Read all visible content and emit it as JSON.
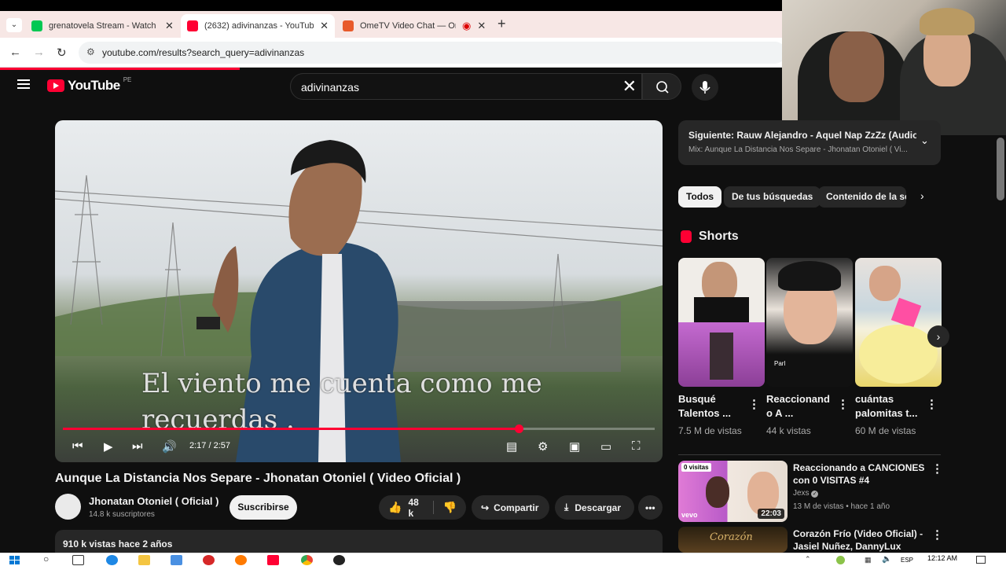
{
  "browser": {
    "tabs": [
      {
        "label": "grenatovela Stream - Watch Liv",
        "color": "#00c853"
      },
      {
        "label": "(2632) adivinanzas - YouTube",
        "color": "#ff0033"
      },
      {
        "label": "OmeTV Video Chat — Ome",
        "color": "#e85a2b"
      }
    ],
    "new_tab": "+",
    "url": "youtube.com/results?search_query=adivinanzas"
  },
  "youtube": {
    "logo_text": "YouTube",
    "country_code": "PE",
    "search_value": "adivinanzas"
  },
  "player": {
    "subtitle_line1": "El viento me cuenta como me",
    "subtitle_line2": "recuerdas .",
    "time": "2:17 / 2:57",
    "progress_fraction": 0.77
  },
  "video": {
    "title": "Aunque La Distancia Nos Separe - Jhonatan Otoniel ( Video Oficial )",
    "channel": "Jhonatan Otoniel ( Oficial )",
    "subscribers": "14.8 k suscriptores",
    "subscribe_label": "Suscribirse",
    "likes": "48 k",
    "share_label": "Compartir",
    "download_label": "Descargar",
    "views_date": "910 k vistas  hace 2 años"
  },
  "sidebar": {
    "next_label": "Siguiente: Rauw Alejandro - Aquel Nap ZzZz (Audio ...",
    "next_sub": "Mix: Aunque La Distancia Nos Separe - Jhonatan Otoniel ( Vi...",
    "chips": [
      "Todos",
      "De tus búsquedas",
      "Contenido de la ser"
    ],
    "shorts_title": "Shorts",
    "shorts": [
      {
        "title": "Busqué Talentos ...",
        "views": "7.5 M de vistas"
      },
      {
        "title": "Reaccionand o A ...",
        "views": "44 k vistas",
        "overlay": "Parl"
      },
      {
        "title": "cuántas palomitas t...",
        "views": "60 M de vistas"
      }
    ],
    "related": [
      {
        "title": "Reaccionando a CANCIONES con 0 VISITAS #4",
        "channel": "Jexs",
        "meta": "13 M de vistas • hace 1 año",
        "duration": "22:03",
        "badge": "0 visitas",
        "brand": "vevo"
      },
      {
        "title": "Corazón Frío (Video Oficial) - Jasiel Nuñez, DannyLux",
        "thumb_text": "Corazón"
      }
    ]
  },
  "taskbar": {
    "time": "12:12 AM",
    "lang": "ESP"
  }
}
